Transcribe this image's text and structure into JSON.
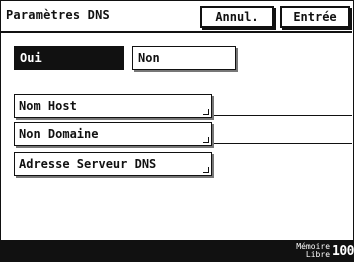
{
  "header": {
    "title": "Paramètres DNS",
    "cancel_label": "Annul.",
    "enter_label": "Entrée"
  },
  "options": {
    "yes_label": "Oui",
    "no_label": "Non",
    "selected": "yes"
  },
  "settings": {
    "items": [
      {
        "label": "Nom Host"
      },
      {
        "label": "Non Domaine"
      },
      {
        "label": "Adresse Serveur DNS"
      }
    ]
  },
  "status": {
    "memory_label_1": "Mémoire",
    "memory_label_2": "Libre",
    "memory_value": "100"
  },
  "colors": {
    "background": "#ffffff",
    "foreground": "#111111",
    "status_bar": "#111111"
  }
}
